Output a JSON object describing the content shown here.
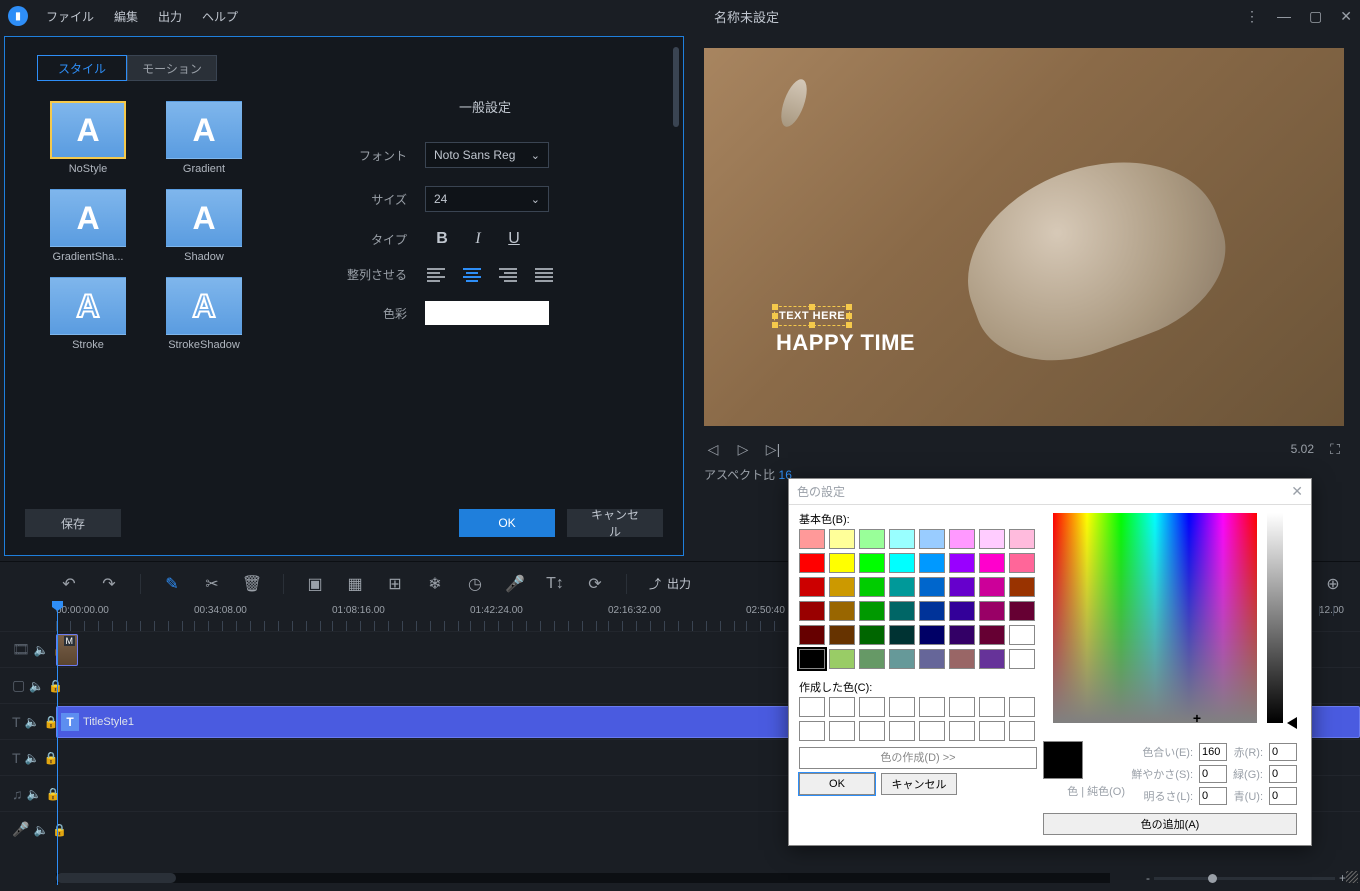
{
  "app": {
    "title": "名称未設定",
    "menu": [
      "ファイル",
      "編集",
      "出力",
      "ヘルプ"
    ]
  },
  "stylePanel": {
    "tabs": {
      "style": "スタイル",
      "motion": "モーション"
    },
    "presets": [
      "NoStyle",
      "Gradient",
      "GradientSha...",
      "Shadow",
      "Stroke",
      "StrokeShadow"
    ],
    "sectionTitle": "一般設定",
    "labels": {
      "font": "フォント",
      "size": "サイズ",
      "type": "タイプ",
      "align": "整列させる",
      "color": "色彩"
    },
    "fontValue": "Noto Sans Reg",
    "sizeValue": "24",
    "buttons": {
      "save": "保存",
      "ok": "OK",
      "cancel": "キャンセル"
    }
  },
  "preview": {
    "text1": "TEXT HERE",
    "text2": "HAPPY TIME",
    "aspectLabel": "アスペクト比",
    "aspectValue": "16",
    "timeRight": "5.02"
  },
  "toolbar": {
    "output": "出力"
  },
  "ruler": [
    "00:00:00.00",
    "00:34:08.00",
    "01:08:16.00",
    "01:42:24.00",
    "02:16:32.00",
    "02:50:40",
    "12.00"
  ],
  "timeline": {
    "title1": "TitleStyle1"
  },
  "colorDialog": {
    "title": "色の設定",
    "basicLabel": "基本色(B):",
    "customLabel": "作成した色(C):",
    "makeColor": "色の作成(D) >>",
    "ok": "OK",
    "cancel": "キャンセル",
    "previewLabel": "色 | 純色(O)",
    "hueLabel": "色合い(E):",
    "satLabel": "鮮やかさ(S):",
    "lumLabel": "明るさ(L):",
    "rLabel": "赤(R):",
    "gLabel": "緑(G):",
    "bLabel": "青(U):",
    "hue": "160",
    "sat": "0",
    "lum": "0",
    "r": "0",
    "g": "0",
    "b": "0",
    "addColor": "色の追加(A)",
    "basicColors": [
      "#f99",
      "#ff9",
      "#9f9",
      "#9ff",
      "#9cf",
      "#f9f",
      "#fcf",
      "#fbd",
      "#f00",
      "#ff0",
      "#0f0",
      "#0ff",
      "#09f",
      "#90f",
      "#f0c",
      "#f69",
      "#c00",
      "#c90",
      "#0c0",
      "#099",
      "#06c",
      "#60c",
      "#c09",
      "#930",
      "#900",
      "#960",
      "#090",
      "#066",
      "#039",
      "#309",
      "#906",
      "#603",
      "#600",
      "#630",
      "#060",
      "#033",
      "#006",
      "#306",
      "#603",
      "#fff",
      "#000",
      "#9c6",
      "#696",
      "#699",
      "#669",
      "#966",
      "#639",
      "#fff"
    ]
  }
}
